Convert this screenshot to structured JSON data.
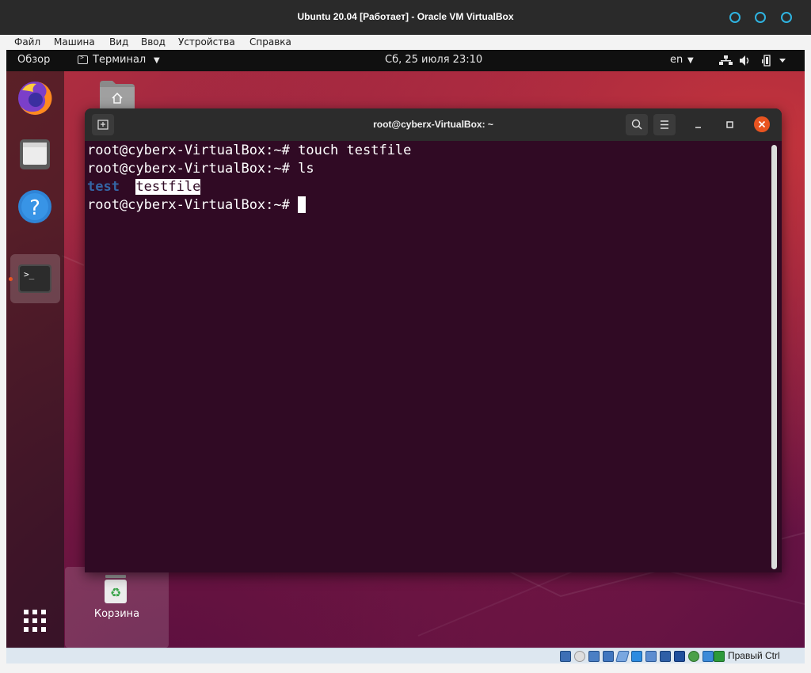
{
  "vbox": {
    "title": "Ubuntu 20.04 [Работает] - Oracle VM VirtualBox",
    "menu": [
      "Файл",
      "Машина",
      "Вид",
      "Ввод",
      "Устройства",
      "Справка"
    ],
    "host_key": "Правый Ctrl"
  },
  "topbar": {
    "activities": "Обзор",
    "app_menu": "Терминал",
    "clock": "Сб, 25 июля  23:10",
    "lang": "en"
  },
  "desktop": {
    "trash_label": "Корзина"
  },
  "terminal": {
    "title": "root@cyberx-VirtualBox: ~",
    "lines": [
      "root@cyberx-VirtualBox:~# touch testfile",
      "root@cyberx-VirtualBox:~# ls"
    ],
    "ls_output": [
      "test",
      "testfile"
    ],
    "prompt": "root@cyberx-VirtualBox:~# "
  },
  "colors": {
    "accent_circle": "#2fb3e0",
    "terminal_bg": "#300a24",
    "dir_blue": "#3465a4",
    "close_orange": "#e95420"
  },
  "icons": {
    "dock": [
      "firefox-icon",
      "files-icon",
      "help-icon",
      "terminal-icon",
      "app-grid-icon"
    ],
    "status": [
      "network-icon",
      "volume-icon",
      "battery-icon",
      "power-icon"
    ]
  }
}
